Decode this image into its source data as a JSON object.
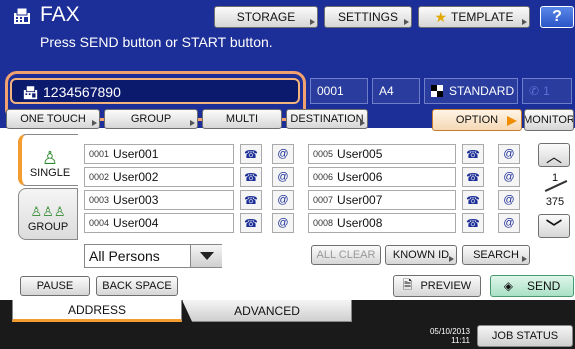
{
  "header": {
    "title": "FAX",
    "prompt": "Press SEND button or START button.",
    "storage_label": "STORAGE",
    "settings_label": "SETTINGS",
    "template_label": "TEMPLATE",
    "help_label": "?"
  },
  "destination": {
    "number": "1234567890",
    "count": "0001",
    "paper_size": "A4",
    "resolution": "STANDARD",
    "line": "1"
  },
  "tabs_row": {
    "one_touch_label": "ONE TOUCH",
    "group_label": "GROUP",
    "multi_label": "MULTI",
    "destination_label": "DESTINATION",
    "option_label": "OPTION",
    "monitor_label": "MONITOR"
  },
  "side_tabs": {
    "single_label": "SINGLE",
    "group_label": "GROUP"
  },
  "entries_left": [
    {
      "num": "0001",
      "name": "User001"
    },
    {
      "num": "0002",
      "name": "User002"
    },
    {
      "num": "0003",
      "name": "User003"
    },
    {
      "num": "0004",
      "name": "User004"
    }
  ],
  "entries_right": [
    {
      "num": "0005",
      "name": "User005"
    },
    {
      "num": "0006",
      "name": "User006"
    },
    {
      "num": "0007",
      "name": "User007"
    },
    {
      "num": "0008",
      "name": "User008"
    }
  ],
  "icons": {
    "fax": "fax-icon",
    "email": "@"
  },
  "pagination": {
    "current": "1",
    "total": "375"
  },
  "filter": {
    "selected": "All Persons"
  },
  "list_actions": {
    "all_clear_label": "ALL CLEAR",
    "known_id_label": "KNOWN ID",
    "search_label": "SEARCH"
  },
  "bottom": {
    "pause_label": "PAUSE",
    "backspace_label": "BACK SPACE",
    "preview_label": "PREVIEW",
    "send_label": "SEND"
  },
  "footer": {
    "address_label": "ADDRESS",
    "advanced_label": "ADVANCED",
    "date": "05/10/2013",
    "time": "11:11",
    "job_status_label": "JOB STATUS"
  },
  "colors": {
    "header_bg": "#1c2e97",
    "highlight": "#f1a06f",
    "send_green": "#a9e1c5",
    "accent_orange": "#f39c2f"
  }
}
